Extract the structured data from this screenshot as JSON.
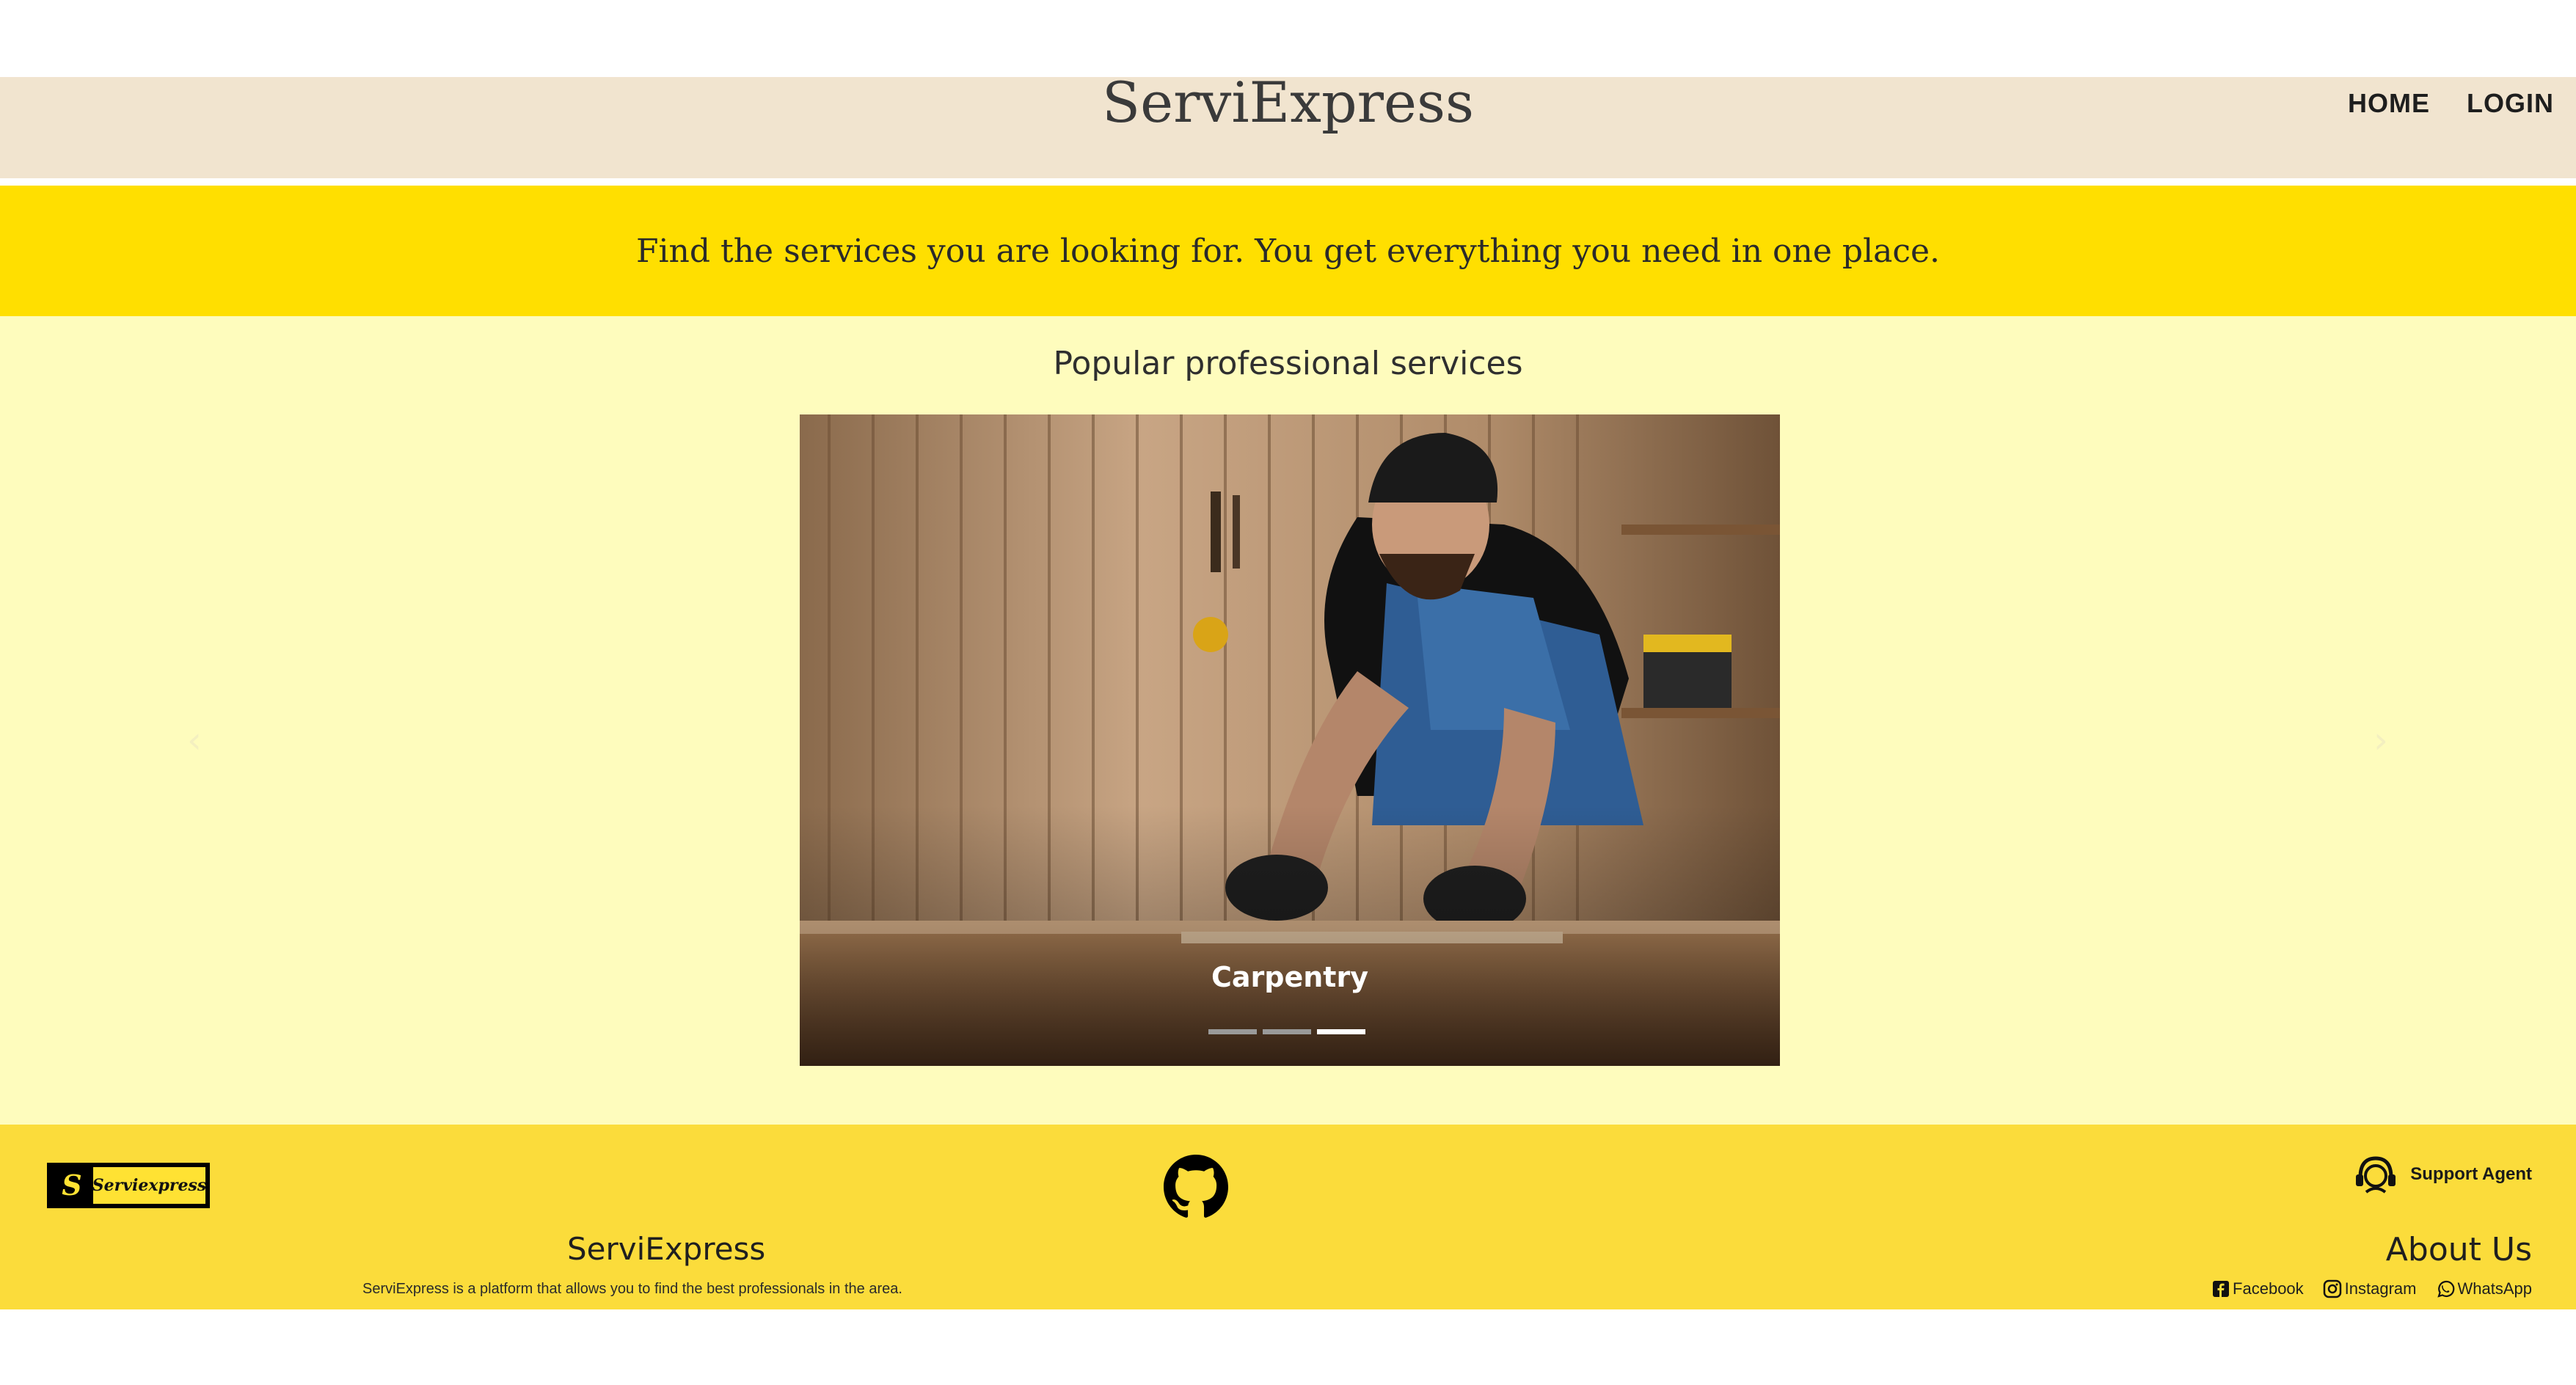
{
  "header": {
    "brand": "ServiExpress",
    "nav": [
      {
        "label": "HOME"
      },
      {
        "label": "LOGIN"
      }
    ]
  },
  "banner": {
    "text": "Find the services you are looking for. You get everything you need in one place."
  },
  "main": {
    "section_title": "Popular professional services",
    "carousel": {
      "caption": "Carpentry",
      "indicator_count": 3,
      "active_index": 2
    }
  },
  "footer": {
    "logo_text": "Serviexpress",
    "logo_letter": "S",
    "support_label": "Support Agent",
    "brand": "ServiExpress",
    "description": "ServiExpress is a platform that allows you to find the best professionals in the area.",
    "about": "About Us",
    "social": [
      {
        "label": "Facebook"
      },
      {
        "label": "Instagram"
      },
      {
        "label": "WhatsApp"
      }
    ]
  },
  "colors": {
    "header_bg": "#f1e4cf",
    "banner_bg": "#ffdf00",
    "main_bg": "#fefcbd",
    "footer_bg": "#fbdc3b"
  }
}
